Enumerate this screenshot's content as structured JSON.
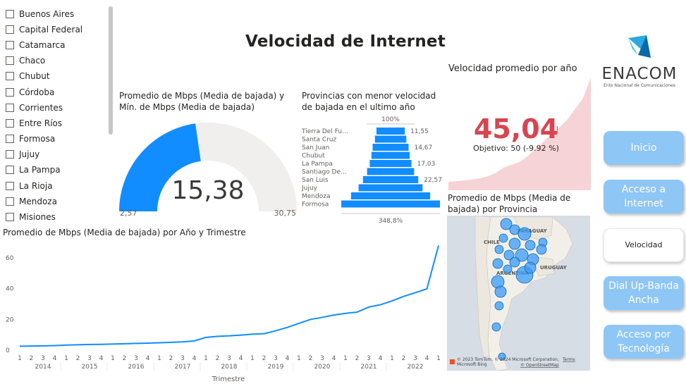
{
  "page_title": "Velocidad de Internet",
  "slicer": {
    "items": [
      "Buenos Aires",
      "Capital Federal",
      "Catamarca",
      "Chaco",
      "Chubut",
      "Córdoba",
      "Corrientes",
      "Entre Ríos",
      "Formosa",
      "Jujuy",
      "La Pampa",
      "La Rioja",
      "Mendoza",
      "Misiones"
    ]
  },
  "gauge": {
    "title": "Promedio de Mbps (Media de bajada) y Mín. de Mbps (Media de bajada)",
    "value": "15,38",
    "min": "2,57",
    "max": "30,75",
    "value_num": 15.38,
    "min_num": 2.57,
    "max_num": 30.75,
    "fill_color": "#118dff",
    "track_color": "#f0efee"
  },
  "funnel": {
    "title": "Provincias con menor velocidad de bajada en el ultimo año",
    "top_pct": "100%",
    "bottom_pct": "348,8%",
    "rows": [
      {
        "label": "Tierra Del Fu...",
        "value": 11.55,
        "value_label": "11,55"
      },
      {
        "label": "Santa Cruz",
        "value": 12.8,
        "value_label": ""
      },
      {
        "label": "San Juan",
        "value": 14.67,
        "value_label": "14,67"
      },
      {
        "label": "Chubut",
        "value": 15.6,
        "value_label": ""
      },
      {
        "label": "La Pampa",
        "value": 17.03,
        "value_label": "17,03"
      },
      {
        "label": "Santiago De...",
        "value": 19.2,
        "value_label": ""
      },
      {
        "label": "San Luis",
        "value": 22.57,
        "value_label": "22,57"
      },
      {
        "label": "Jujuy",
        "value": 26.1,
        "value_label": ""
      },
      {
        "label": "Mendoza",
        "value": 32.3,
        "value_label": ""
      },
      {
        "label": "Formosa",
        "value": 40.28,
        "value_label": ""
      }
    ],
    "bar_color": "#118dff"
  },
  "kpi": {
    "title": "Velocidad promedio por año",
    "value": "45,04",
    "alert": "!",
    "goal": "Objetivo: 50 (-9.92 %)",
    "value_color": "#d64550",
    "area_color": "#f6d3d6",
    "trend": [
      3.4,
      3.6,
      3.9,
      4.3,
      4.8,
      5.6,
      6.9,
      9.1,
      10.2,
      11.3,
      13.6,
      16.5,
      19.4,
      22.4,
      24.9,
      28.1,
      32.4,
      36.7,
      45.04
    ]
  },
  "map": {
    "title": "Promedio de Mbps (Media de bajada) por Provincia",
    "labels": [
      "PARAGUAY",
      "CHILE",
      "URUGUAY",
      "ARGENTINA"
    ],
    "attribution_1": "© 2023 TomTom, © 2024 Microsoft Corporation,",
    "attribution_terms": "Terms",
    "attribution_2": "© OpenStreetMap",
    "brand": "Microsoft Bing",
    "bubble_color": "#118dff"
  },
  "line_chart": {
    "title": "Promedio de Mbps (Media de bajada) por Año y Trimestre",
    "xlabel": "Trimestre"
  },
  "chart_data": {
    "type": "line",
    "title": "Promedio de Mbps (Media de bajada) por Año y Trimestre",
    "xlabel": "Trimestre",
    "ylabel": "",
    "ylim": [
      0,
      70
    ],
    "yticks": [
      0,
      20,
      40,
      60
    ],
    "years": [
      "2014",
      "2015",
      "2016",
      "2017",
      "2018",
      "2019",
      "2020",
      "2021",
      "2022"
    ],
    "quarters": [
      "1",
      "2",
      "3",
      "4"
    ],
    "series": [
      {
        "values": [
          2.6,
          2.7,
          2.8,
          3.0,
          3.3,
          3.5,
          3.7,
          3.8,
          4.0,
          4.2,
          4.4,
          4.6,
          4.8,
          5.1,
          5.4,
          6.0,
          8.3,
          9.0,
          9.3,
          9.8,
          10.4,
          10.7,
          12.6,
          14.8,
          17.4,
          20.0,
          21.3,
          22.8,
          23.9,
          24.7,
          28.0,
          29.5,
          32.0,
          34.9,
          37.3,
          39.8,
          68.0
        ]
      }
    ],
    "grid": false,
    "line_color": "#118dff"
  },
  "nav": {
    "inicio": "Inicio",
    "acceso_internet": "Acceso a Internet",
    "velocidad": "Velocidad",
    "dial_up": "Dial Up-Banda Ancha",
    "acceso_tecnologia": "Acceso por Tecnología"
  },
  "logo": {
    "name": "ENACOM",
    "tagline": "Ente Nacional de Comunicaciones",
    "colors": [
      "#29a9e1",
      "#0b6aa8",
      "#5ccaf0"
    ]
  }
}
